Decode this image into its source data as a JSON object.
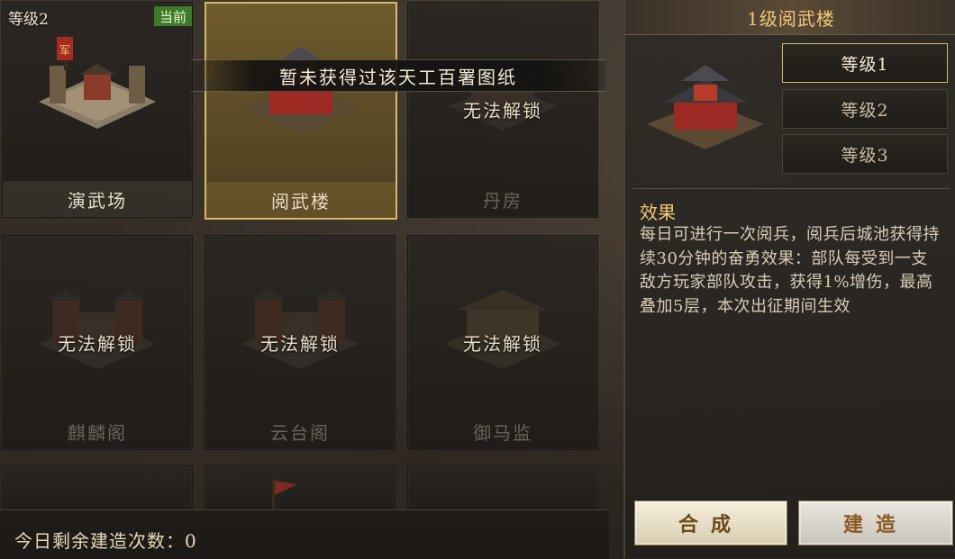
{
  "tooltip": "暂未获得过该天工百署图纸",
  "cards": [
    {
      "name": "演武场",
      "level_text": "等级2",
      "badge": "当前",
      "locked_text": ""
    },
    {
      "name": "阅武楼",
      "locked_text": ""
    },
    {
      "name": "丹房",
      "locked_text": "无法解锁"
    },
    {
      "name": "麒麟阁",
      "locked_text": "无法解锁"
    },
    {
      "name": "云台阁",
      "locked_text": "无法解锁"
    },
    {
      "name": "御马监",
      "locked_text": "无法解锁"
    }
  ],
  "bottom_bar": {
    "remaining_label": "今日剩余建造次数：0"
  },
  "panel": {
    "title": "1级阅武楼",
    "levels": [
      "等级1",
      "等级2",
      "等级3"
    ],
    "selected_level": "等级1",
    "effect_title": "效果",
    "effect_text": "每日可进行一次阅兵，阅兵后城池获得持续30分钟的奋勇效果：部队每受到一支敌方玩家部队攻击，获得1%增伤，最高叠加5层，本次出征期间生效",
    "synth_button": "合成",
    "build_button": "建造"
  },
  "colors": {
    "accent_gold": "#d6b867",
    "title_gold": "#f2c97a",
    "badge_green": "#3d7a2a"
  }
}
